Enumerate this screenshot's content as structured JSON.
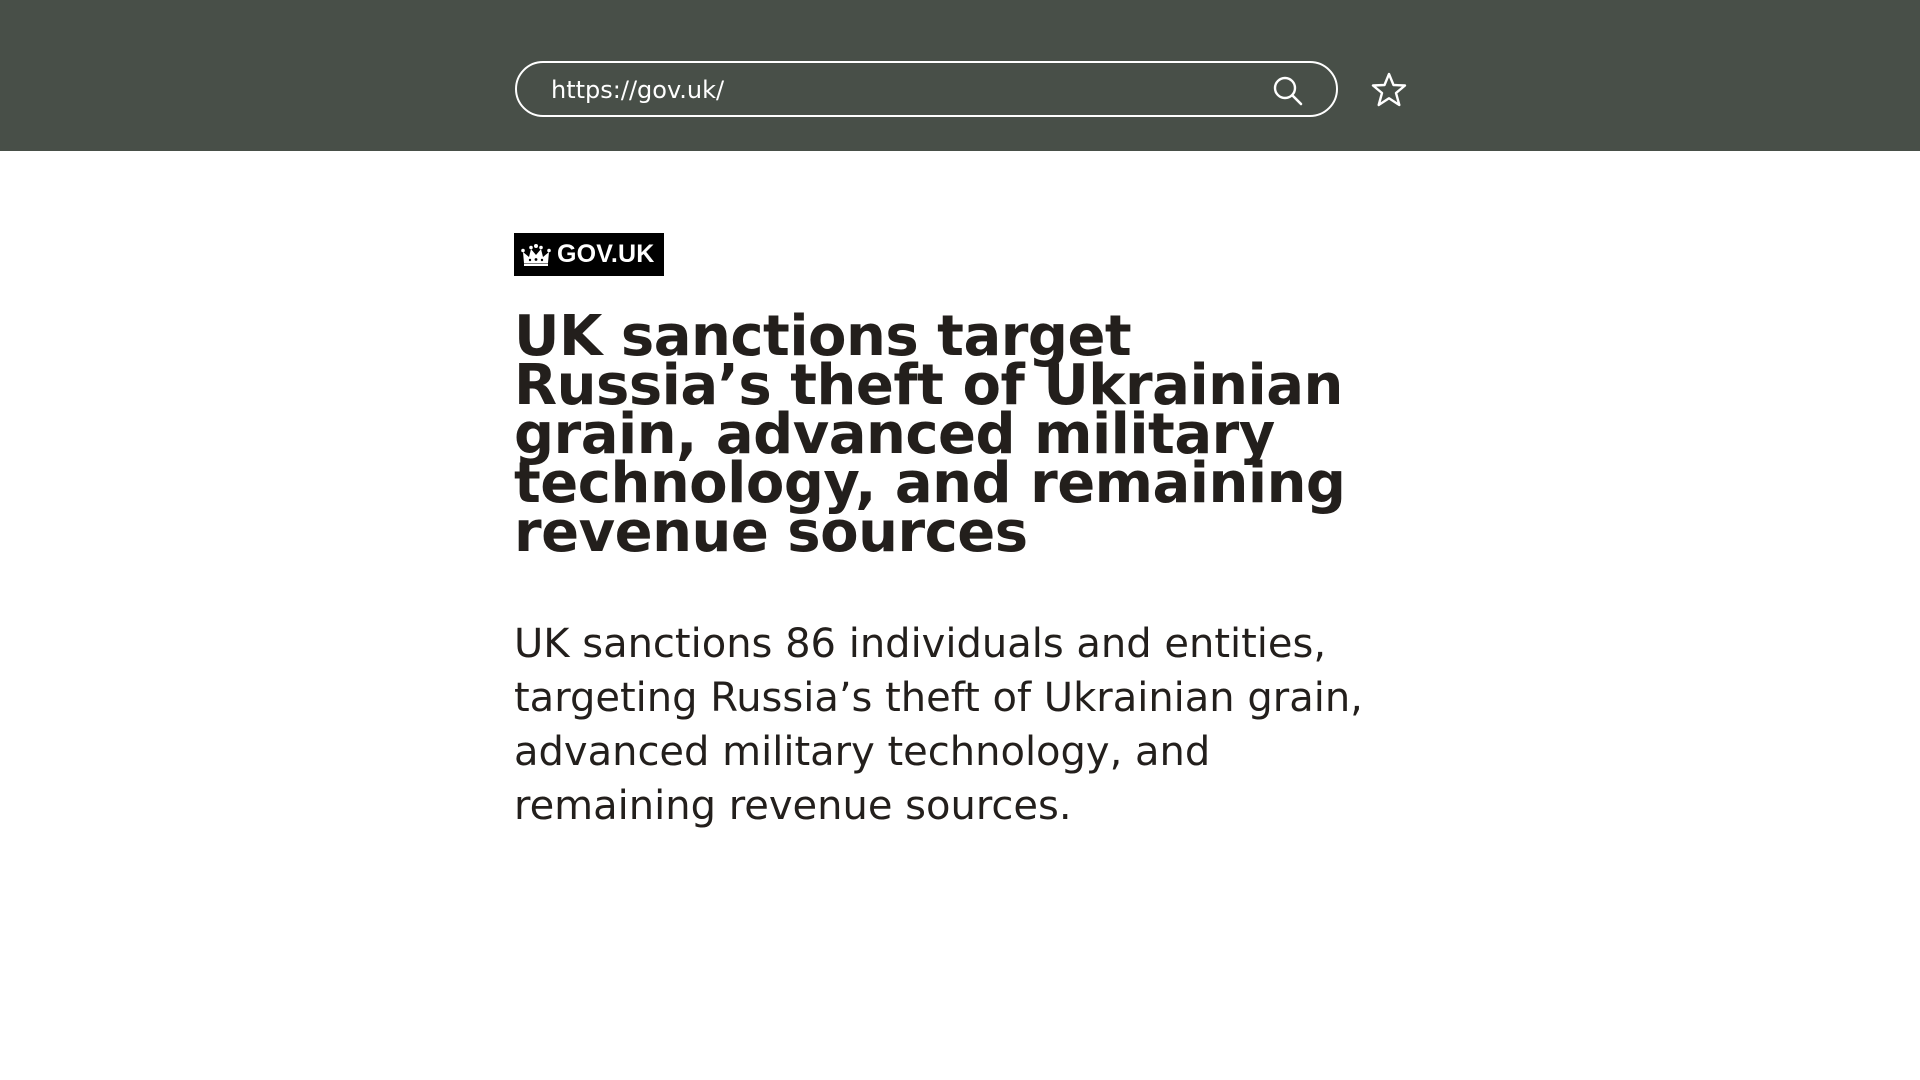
{
  "browser": {
    "url": "https://gov.uk/",
    "icons": {
      "search": "search-icon",
      "bookmark": "star-icon"
    },
    "colors": {
      "topbar": "#484f48",
      "foreground": "#ffffff"
    }
  },
  "page": {
    "logo_text": "GOV.UK",
    "logo_icon": "crown-icon",
    "headline": "UK sanctions target Russia’s theft of Ukrainian grain, advanced military technology, and remaining revenue sources",
    "summary": "UK sanctions 86 individuals and entities, targeting Russia’s theft of Ukrainian grain, advanced military technology, and remaining revenue sources.",
    "colors": {
      "text": "#231f1c",
      "logo_background": "#000000"
    }
  }
}
